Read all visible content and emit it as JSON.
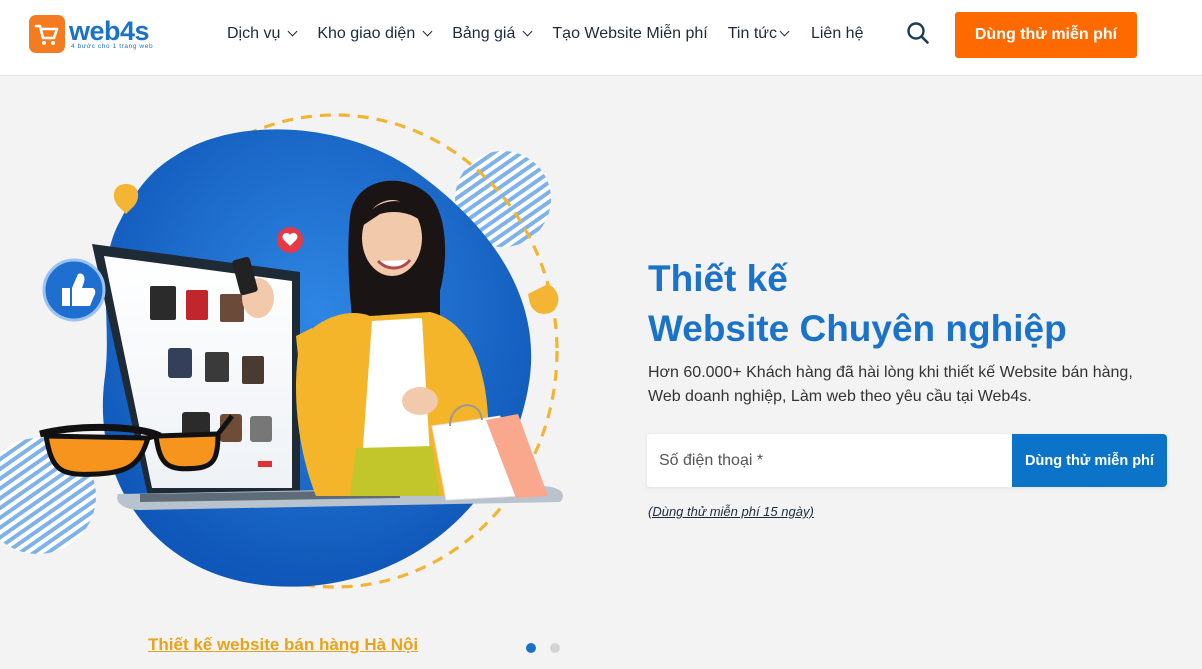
{
  "brand": {
    "name": "web4s",
    "tagline": "4 bước cho 1 trang web",
    "color": "#1b73c9",
    "accent": "#f47b20"
  },
  "nav": {
    "items": [
      {
        "label": "Dịch vụ",
        "dropdown": true
      },
      {
        "label": "Kho giao diện",
        "dropdown": true
      },
      {
        "label": "Bảng giá",
        "dropdown": true
      },
      {
        "label": "Tạo Website Miễn phí",
        "dropdown": false
      },
      {
        "label": "Tin tức",
        "dropdown": true
      },
      {
        "label": "Liên hệ",
        "dropdown": false
      }
    ],
    "search_icon": "search-icon",
    "cta_label": "Dùng thử miễn phí",
    "cta_color": "#ff6a00"
  },
  "hero": {
    "title_line1": "Thiết kế",
    "title_line2": "Website Chuyên nghiệp",
    "description": "Hơn 60.000+ Khách hàng đã hài lòng khi thiết kế Website bán hàng, Web doanh nghiệp, Làm web theo yêu cầu tại Web4s.",
    "phone_placeholder": "Số điện thoại *",
    "phone_value": "",
    "submit_label": "Dùng thử miễn phí",
    "trial_note": "(Dùng thử miễn phí 15 ngày)",
    "illustration": "woman-with-laptop-shopping"
  },
  "slider": {
    "caption": "Thiết kế website bán hàng Hà Nội",
    "total_slides": 2,
    "active_slide": 1
  }
}
